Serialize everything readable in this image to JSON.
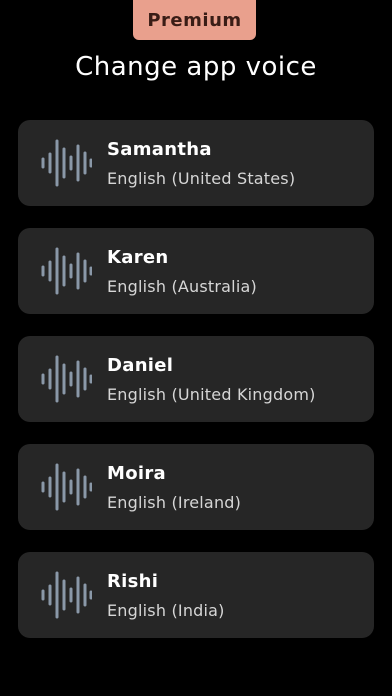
{
  "header": {
    "badge_label": "Premium",
    "title": "Change app voice"
  },
  "colors": {
    "background": "#000000",
    "card": "#262626",
    "badge": "#e9a08d",
    "wave_icon": "#8a98a8"
  },
  "voices": [
    {
      "name": "Samantha",
      "language": "English (United States)",
      "icon": "sound-wave-icon"
    },
    {
      "name": "Karen",
      "language": "English (Australia)",
      "icon": "sound-wave-icon"
    },
    {
      "name": "Daniel",
      "language": "English (United Kingdom)",
      "icon": "sound-wave-icon"
    },
    {
      "name": "Moira",
      "language": "English (Ireland)",
      "icon": "sound-wave-icon"
    },
    {
      "name": "Rishi",
      "language": "English (India)",
      "icon": "sound-wave-icon"
    }
  ]
}
